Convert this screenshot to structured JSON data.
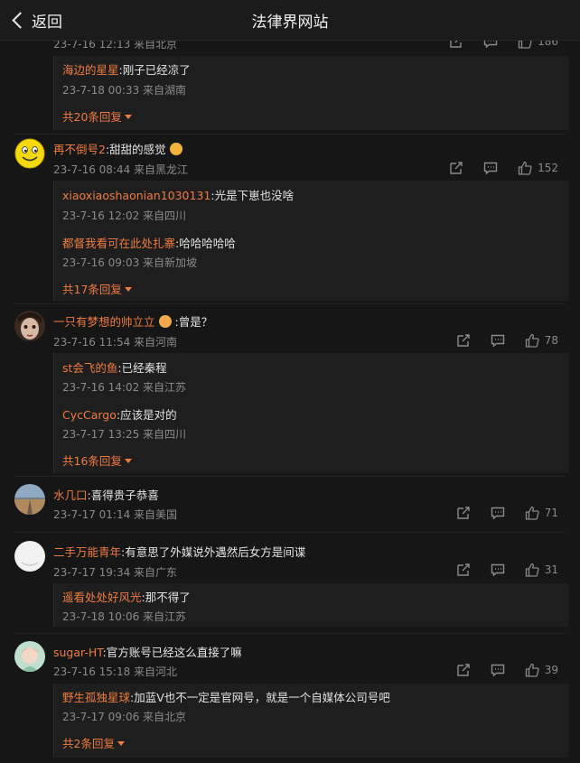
{
  "header": {
    "back_label": "返回",
    "title": "法律界网站"
  },
  "top_partial": {
    "meta": "23-7-16 12:13 来自北京",
    "likes": "186",
    "replies": [
      {
        "user": "海边的星星",
        "text": ":刚子已经凉了",
        "meta": "23-7-18 00:33 来自湖南"
      }
    ],
    "more": "共20条回复"
  },
  "comments": [
    {
      "user": "再不倒号2",
      "text": ":甜甜的感觉",
      "meta": "23-7-16 08:44 来自黑龙江",
      "likes": "152",
      "replies": [
        {
          "user": "xiaoxiaoshaonian1030131",
          "text": ":光是下崽也没啥",
          "meta": "23-7-16 12:02 来自四川"
        },
        {
          "user": "都督我看可在此处扎寨",
          "text": ":哈哈哈哈哈",
          "meta": "23-7-16 09:03 来自新加坡"
        }
      ],
      "more": "共17条回复"
    },
    {
      "user": "一只有梦想的帅立立",
      "text": ":曾是？",
      "meta": "23-7-16 11:54 来自河南",
      "likes": "78",
      "replies": [
        {
          "user": "st会飞的鱼",
          "text": ":已经秦程",
          "meta": "23-7-16 14:02 来自江苏"
        },
        {
          "user": "CycCargo",
          "text": ":应该是对的",
          "meta": "23-7-17 13:25 来自四川"
        }
      ],
      "more": "共16条回复"
    },
    {
      "user": "水几口",
      "text": ":喜得贵子恭喜",
      "meta": "23-7-17 01:14 来自美国",
      "likes": "71"
    },
    {
      "user": "二手万能青年",
      "text": ":有意思了外媒说外遇然后女方是间谍",
      "meta": "23-7-17 19:34 来自广东",
      "likes": "31",
      "replies": [
        {
          "user": "遥看处处好风光",
          "text": ":那不得了",
          "meta": "23-7-18 10:06 来自江苏"
        }
      ]
    },
    {
      "user": "sugar-HT",
      "text": ":官方账号已经这么直接了嘛",
      "meta": "23-7-16 15:18 来自河北",
      "likes": "39",
      "replies": [
        {
          "user": "野生孤独星球",
          "text": ":加蓝V也不一定是官网号，就是一个自媒体公司号吧",
          "meta": "23-7-17 09:06 来自北京"
        }
      ],
      "more": "共2条回复"
    }
  ],
  "icons": {
    "share": "share-icon",
    "comment": "comment-icon",
    "like": "thumbs-up-icon",
    "back": "chevron-left-icon"
  },
  "colors": {
    "username": "#f07b3f",
    "meta": "#8a8a8a",
    "background": "#161616"
  }
}
